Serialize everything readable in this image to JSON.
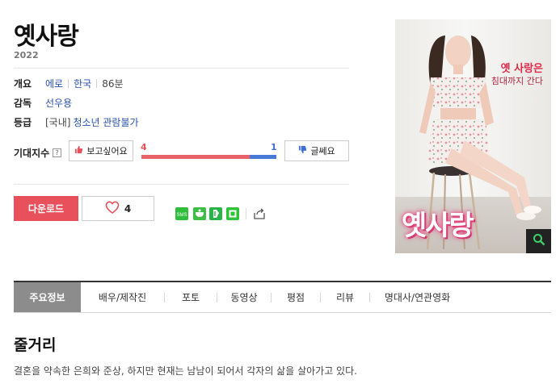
{
  "movie": {
    "title": "옛사랑",
    "year": "2022"
  },
  "info": {
    "overview_label": "개요",
    "genre": "에로",
    "country": "한국",
    "runtime": "86분",
    "director_label": "감독",
    "director": "선우용",
    "rating_label": "등급",
    "rating_prefix": "[국내]",
    "rating": "청소년 관람불가"
  },
  "expectation": {
    "label": "기대지수",
    "help_icon": "question-icon",
    "want_label": "보고싶어요",
    "meh_label": "글쎄요",
    "want_count": "4",
    "meh_count": "1",
    "want_ratio": 0.8,
    "colors": {
      "want": "#e8505b",
      "meh": "#3f6fd8"
    }
  },
  "actions": {
    "download_label": "다운로드",
    "like_count": "4",
    "share_icons": [
      "sms-icon",
      "kakaostory-icon",
      "band-icon",
      "line-icon"
    ],
    "export_icon": "share-export-icon"
  },
  "poster": {
    "caption_line1": "옛 사랑은",
    "caption_line2": "침대까지 간다",
    "logo_text": "옛사랑",
    "zoom_icon": "magnifier-icon"
  },
  "tabs": [
    {
      "label": "주요정보",
      "active": true
    },
    {
      "label": "배우/제작진",
      "active": false
    },
    {
      "label": "포토",
      "active": false
    },
    {
      "label": "동영상",
      "active": false
    },
    {
      "label": "평점",
      "active": false
    },
    {
      "label": "리뷰",
      "active": false
    },
    {
      "label": "명대사/연관영화",
      "active": false
    }
  ],
  "synopsis": {
    "title": "줄거리",
    "text": "결혼을 약속한 은희와 준상, 하지만 현재는 남남이 되어서 각자의 삶을 살아가고 있다."
  }
}
